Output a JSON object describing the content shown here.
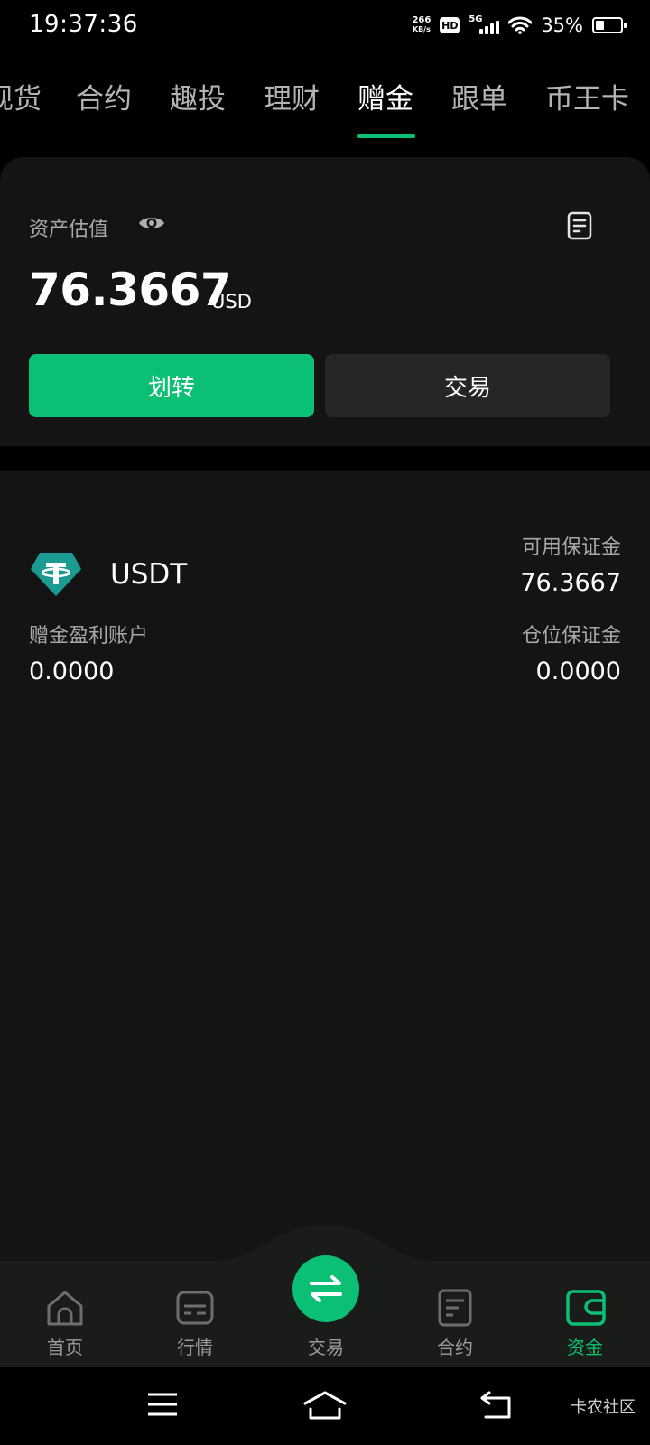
{
  "status_bar": {
    "time": "19:37:36",
    "net_speed_value": "266",
    "net_speed_unit": "KB/s",
    "hd_label": "HD",
    "network_label": "5G",
    "battery_percent": "35%",
    "battery_level": 0.35
  },
  "top_tabs": [
    {
      "label": "现货",
      "active": false
    },
    {
      "label": "合约",
      "active": false
    },
    {
      "label": "趣投",
      "active": false
    },
    {
      "label": "理财",
      "active": false
    },
    {
      "label": "赠金",
      "active": true
    },
    {
      "label": "跟单",
      "active": false
    },
    {
      "label": "币王卡",
      "active": false
    }
  ],
  "asset": {
    "title": "资产估值",
    "amount": "76.3667",
    "unit": "USD",
    "transfer_label": "划转",
    "trade_label": "交易"
  },
  "account": {
    "coin": "USDT",
    "available_margin_label": "可用保证金",
    "available_margin_value": "76.3667",
    "bonus_profit_label": "赠金盈利账户",
    "bonus_profit_value": "0.0000",
    "position_margin_label": "仓位保证金",
    "position_margin_value": "0.0000"
  },
  "bottom_nav": [
    {
      "label": "首页",
      "icon": "home-icon",
      "active": false
    },
    {
      "label": "行情",
      "icon": "market-icon",
      "active": false
    },
    {
      "label": "交易",
      "icon": "swap-icon",
      "active": false
    },
    {
      "label": "合约",
      "icon": "contract-icon",
      "active": false
    },
    {
      "label": "资金",
      "icon": "wallet-icon",
      "active": true
    }
  ],
  "watermark": "卡农社区",
  "colors": {
    "accent": "#0bbf74",
    "background": "#000000",
    "card": "#141414",
    "secondary_button": "#262626",
    "tether": "#1a9a91"
  }
}
